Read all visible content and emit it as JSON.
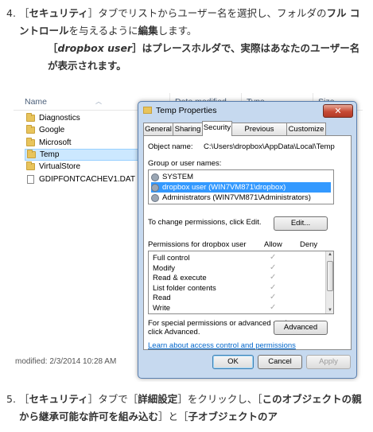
{
  "step4": {
    "number": "4.",
    "segments": [
      {
        "t": "［",
        "b": false
      },
      {
        "t": "セキュリティ",
        "b": true
      },
      {
        "t": "］タブでリストからユーザー名を選択し、フォルダの",
        "b": false
      },
      {
        "t": "フル コントロール",
        "b": true
      },
      {
        "t": "を与えるように",
        "b": false
      },
      {
        "t": "編集",
        "b": true
      },
      {
        "t": "します。",
        "b": false
      }
    ]
  },
  "note": {
    "bracket_open": "［",
    "placeholder": "dropbox user",
    "rest": "］はプレースホルダで、実際はあなたのユーザー名が表示されます。"
  },
  "step5": {
    "number": "5.",
    "segments": [
      {
        "t": "［",
        "b": false
      },
      {
        "t": "セキュリティ",
        "b": true
      },
      {
        "t": "］タブで［",
        "b": false
      },
      {
        "t": "詳細設定",
        "b": true
      },
      {
        "t": "］をクリックし、［",
        "b": false
      },
      {
        "t": "このオブジェクトの親から継承可能な許可を組み込む",
        "b": true
      },
      {
        "t": "］と［",
        "b": false
      },
      {
        "t": "子オブジェクトのア",
        "b": true
      }
    ]
  },
  "explorer": {
    "columns": {
      "name": "Name",
      "date": "Date modified",
      "type": "Type",
      "size": "Size"
    },
    "files": [
      {
        "name": "Diagnostics",
        "kind": "folder"
      },
      {
        "name": "Google",
        "kind": "folder"
      },
      {
        "name": "Microsoft",
        "kind": "folder"
      },
      {
        "name": "Temp",
        "kind": "folder",
        "selected": true
      },
      {
        "name": "VirtualStore",
        "kind": "folder"
      },
      {
        "name": "GDIPFONTCACHEV1.DAT",
        "kind": "file"
      }
    ],
    "status": "modified: 2/3/2014 10:28 AM"
  },
  "dialog": {
    "title": "Temp Properties",
    "close": "✕",
    "tabs": [
      "General",
      "Sharing",
      "Security",
      "Previous Versions",
      "Customize"
    ],
    "active_tab": "Security",
    "object_name_label": "Object name:",
    "object_name_value": "C:\\Users\\dropbox\\AppData\\Local\\Temp",
    "group_label": "Group or user names:",
    "users": [
      {
        "name": "SYSTEM",
        "selected": false
      },
      {
        "name": "dropbox user (WIN7VM871\\dropbox)",
        "selected": true
      },
      {
        "name": "Administrators (WIN7VM871\\Administrators)",
        "selected": false
      }
    ],
    "change_label": "To change permissions, click Edit.",
    "edit_button": "Edit...",
    "perm_header": "Permissions for dropbox user",
    "allow_header": "Allow",
    "deny_header": "Deny",
    "permissions": [
      {
        "name": "Full control",
        "allow": "✓",
        "deny": ""
      },
      {
        "name": "Modify",
        "allow": "✓",
        "deny": ""
      },
      {
        "name": "Read & execute",
        "allow": "✓",
        "deny": ""
      },
      {
        "name": "List folder contents",
        "allow": "✓",
        "deny": ""
      },
      {
        "name": "Read",
        "allow": "✓",
        "deny": ""
      },
      {
        "name": "Write",
        "allow": "✓",
        "deny": ""
      }
    ],
    "special_label_1": "For special permissions or advanced settings,",
    "special_label_2": "click Advanced.",
    "advanced_button": "Advanced",
    "learn_link": "Learn about access control and permissions",
    "ok_button": "OK",
    "cancel_button": "Cancel",
    "apply_button": "Apply"
  },
  "colors": {
    "selection": "#3399ff",
    "link": "#0066cc",
    "close": "#c74a35"
  }
}
